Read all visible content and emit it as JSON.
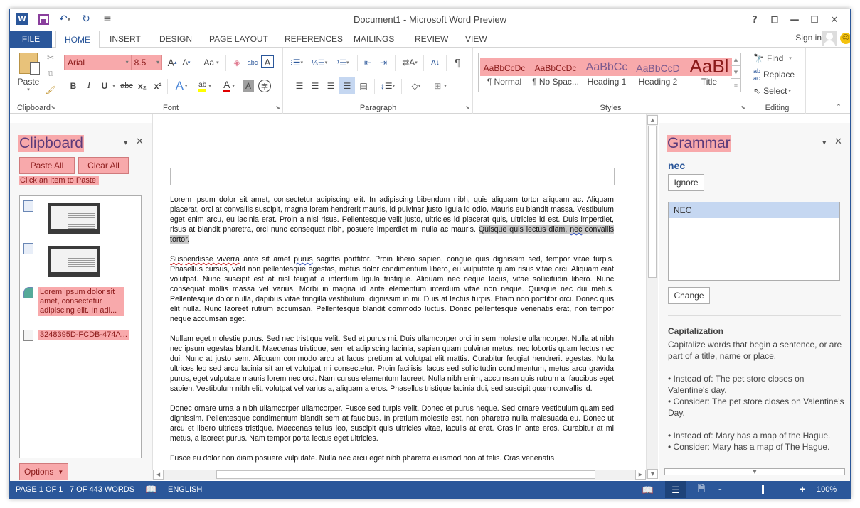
{
  "titlebar": {
    "title": "Document1 - Microsoft Word Preview",
    "qat": [
      "word-logo",
      "save",
      "undo",
      "redo",
      "customize"
    ],
    "help": "?",
    "controls": [
      "restore-ribbon",
      "minimize",
      "maximize",
      "close"
    ]
  },
  "tabs": [
    {
      "label": "FILE"
    },
    {
      "label": "HOME",
      "active": true
    },
    {
      "label": "INSERT"
    },
    {
      "label": "DESIGN"
    },
    {
      "label": "PAGE LAYOUT"
    },
    {
      "label": "REFERENCES"
    },
    {
      "label": "MAILINGS"
    },
    {
      "label": "REVIEW"
    },
    {
      "label": "VIEW"
    }
  ],
  "account": {
    "sign_in": "Sign in"
  },
  "ribbon": {
    "clipboard": {
      "label": "Clipboard",
      "paste": "Paste"
    },
    "font": {
      "label": "Font",
      "font_name": "Arial",
      "font_size": "8.5",
      "grow": "A",
      "shrink": "A",
      "change_case": "Aa",
      "bold": "B",
      "italic": "I",
      "underline": "U",
      "strike": "abc",
      "subscript": "x₂",
      "superscript": "x²",
      "highlight_color": "#ffff00",
      "font_color": "#e00000"
    },
    "paragraph": {
      "label": "Paragraph",
      "pilcrow": "¶"
    },
    "styles": {
      "label": "Styles",
      "items": [
        {
          "sample": "AaBbCcDc",
          "name": "¶ Normal"
        },
        {
          "sample": "AaBbCcDc",
          "name": "¶ No Spac..."
        },
        {
          "sample": "AaBbCc",
          "name": "Heading 1"
        },
        {
          "sample": "AaBbCcD",
          "name": "Heading 2"
        },
        {
          "sample": "AaBl",
          "name": "Title"
        }
      ]
    },
    "editing": {
      "label": "Editing",
      "find": "Find",
      "replace": "Replace",
      "select": "Select"
    }
  },
  "clipboard_pane": {
    "title": "Clipboard",
    "paste_all": "Paste All",
    "clear_all": "Clear All",
    "instruction": "Click an Item to Paste:",
    "items": [
      {
        "type": "image"
      },
      {
        "type": "image"
      },
      {
        "type": "html",
        "text": "Lorem ipsum dolor sit amet, consectetur adipiscing elit. In adi..."
      },
      {
        "type": "text",
        "text": "3248395D-FCDB-474A..."
      }
    ],
    "options": "Options"
  },
  "document": {
    "p1_a": "Lorem ipsum dolor sit amet, consectetur adipiscing elit. In adipiscing bibendum nibh, quis aliquam tortor aliquam ac. Aliquam placerat, orci at convallis suscipit, magna lorem hendrerit mauris, id pulvinar justo ligula id odio. Mauris eu blandit massa. Vestibulum eget enim arcu, eu lacinia erat. Proin a nisi risus. Pellentesque velit justo, ultricies id placerat quis, ultricies id est. Duis imperdiet, risus at blandit pharetra, orci nunc consequat nibh, posuere imperdiet mi nulla ac mauris. ",
    "p1_sel_a": "Quisque quis lectus diam, ",
    "p1_sel_err": "nec",
    "p1_sel_b": " convallis tortor.",
    "p2_err1": "Suspendisse viverra",
    "p2_a": " ante sit amet ",
    "p2_err2": "purus",
    "p2_b": " sagittis porttitor. Proin libero sapien, congue quis dignissim sed, tempor vitae turpis. Phasellus cursus, velit non pellentesque egestas, metus dolor condimentum libero, eu vulputate quam risus vitae orci. Aliquam erat volutpat. Nunc suscipit est at nisl feugiat a interdum ligula tristique. Aliquam nec neque lacus, vitae sollicitudin libero. Nunc consequat mollis massa vel varius. Morbi in magna id ante elementum interdum vitae non neque. Quisque nec dui metus. Pellentesque dolor nulla, dapibus vitae fringilla vestibulum, dignissim in mi. Duis at lectus turpis. Etiam non porttitor orci. Donec quis elit nulla. Nunc laoreet rutrum accumsan. Pellentesque blandit commodo luctus. Donec pellentesque venenatis erat, non tempor neque accumsan eget.",
    "p3": "Nullam eget molestie purus. Sed nec tristique velit. Sed et purus mi. Duis ullamcorper orci in sem molestie ullamcorper. Nulla at nibh nec ipsum egestas blandit. Maecenas tristique, sem et adipiscing lacinia, sapien quam pulvinar metus, nec lobortis quam lectus nec dui. Nunc at justo sem. Aliquam commodo arcu at lacus pretium at volutpat elit mattis. Curabitur feugiat hendrerit egestas. Nulla ultrices leo sed arcu lacinia sit amet volutpat mi consectetur. Proin facilisis, lacus sed sollicitudin condimentum, metus arcu gravida purus, eget vulputate mauris lorem nec orci. Nam cursus elementum laoreet. Nulla nibh enim, accumsan quis rutrum a, faucibus eget sapien. Vestibulum nibh elit, volutpat vel varius a, aliquam a eros. Phasellus tristique lacinia dui, sed suscipit quam convallis id.",
    "p4": "Donec ornare urna a nibh ullamcorper ullamcorper. Fusce sed turpis velit. Donec et purus neque. Sed ornare vestibulum quam sed dignissim. Pellentesque condimentum blandit sem at faucibus. In pretium molestie est, non pharetra nulla malesuada eu. Donec ut arcu et libero ultrices tristique. Maecenas tellus leo, suscipit quis ultricies vitae, iaculis at erat. Cras in ante eros. Curabitur at mi metus, a laoreet purus. Nam tempor porta lectus eget ultricies.",
    "p5": "Fusce eu dolor non diam posuere vulputate. Nulla nec arcu eget nibh pharetra euismod non at felis. Cras venenatis"
  },
  "grammar_pane": {
    "title": "Grammar",
    "word": "nec",
    "ignore": "Ignore",
    "suggestions": [
      "NEC"
    ],
    "change": "Change",
    "rule_title": "Capitalization",
    "rule_desc": "Capitalize words that begin a sentence, or are part of a title, name or place.",
    "example1_instead": "• Instead of: The pet store closes on Valentine's day.",
    "example1_consider": "• Consider: The pet store closes on Valentine's Day.",
    "example2_instead": "• Instead of: Mary has a map of the Hague.",
    "example2_consider": "• Consider: Mary has a map of The Hague."
  },
  "statusbar": {
    "page": "PAGE 1 OF 1",
    "words": "7 OF 443 WORDS",
    "language": "ENGLISH",
    "zoom_percent": "100%",
    "zoom_minus": "-",
    "zoom_plus": "+",
    "zoom_value": 100
  }
}
